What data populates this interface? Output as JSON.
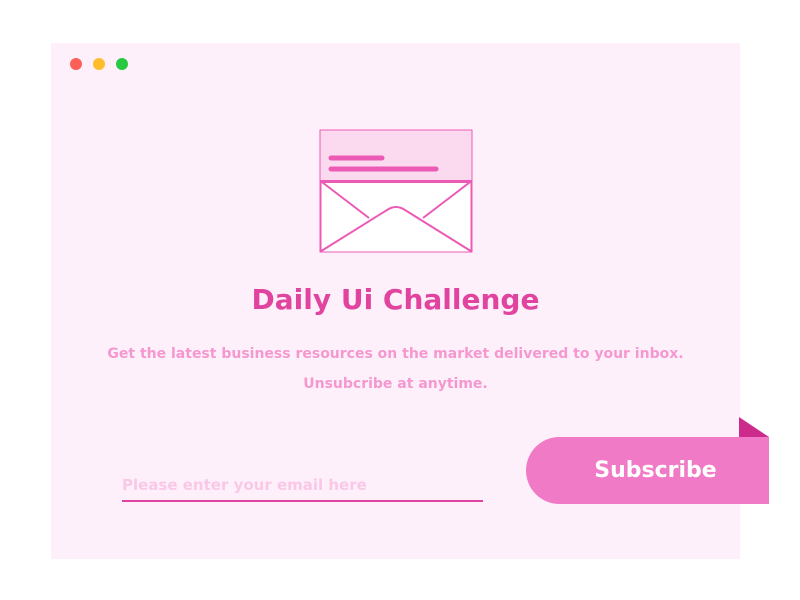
{
  "window": {
    "traffic_lights": [
      {
        "name": "close",
        "color": "#fe5f57"
      },
      {
        "name": "minimize",
        "color": "#ffbd2e"
      },
      {
        "name": "zoom",
        "color": "#29c840"
      }
    ]
  },
  "hero": {
    "icon": "envelope-icon",
    "title": "Daily Ui Challenge",
    "description_line1": "Get the latest business resources on the market delivered to your inbox.",
    "description_line2": "Unsubcribe  at anytime."
  },
  "form": {
    "email_placeholder": "Please enter your email here",
    "email_value": "",
    "subscribe_label": "Subscribe"
  },
  "colors": {
    "background": "#fef0fa",
    "accent": "#e0449f",
    "text_light": "#f598d0",
    "button": "#f07ac6",
    "ribbon_fold": "#cc2b8c",
    "placeholder": "#f9c8e7"
  }
}
